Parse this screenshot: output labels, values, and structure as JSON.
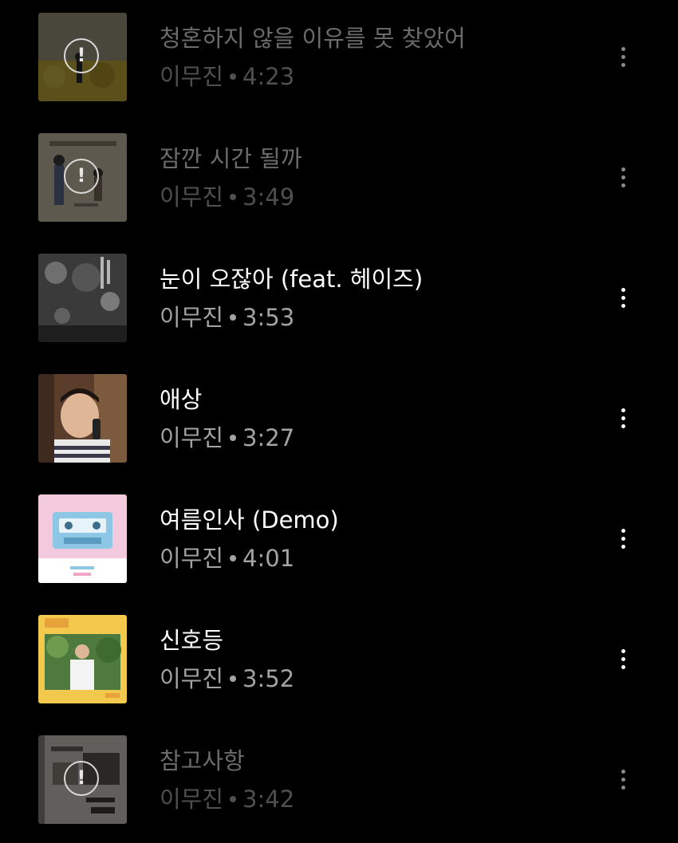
{
  "songs": [
    {
      "title": "청혼하지 않을 이유를 못 찾았어",
      "artist": "이무진",
      "duration": "4:23",
      "available": false,
      "art_icon": "field-silhouette-art"
    },
    {
      "title": "잠깐 시간 될까",
      "artist": "이무진",
      "duration": "3:49",
      "available": false,
      "art_icon": "sketch-art"
    },
    {
      "title": "눈이 오잖아 (feat. 헤이즈)",
      "artist": "이무진",
      "duration": "3:53",
      "available": true,
      "art_icon": "snow-night-art"
    },
    {
      "title": "애상",
      "artist": "이무진",
      "duration": "3:27",
      "available": true,
      "art_icon": "portrait-phone-art"
    },
    {
      "title": "여름인사 (Demo)",
      "artist": "이무진",
      "duration": "4:01",
      "available": true,
      "art_icon": "cassette-art"
    },
    {
      "title": "신호등",
      "artist": "이무진",
      "duration": "3:52",
      "available": true,
      "art_icon": "yellow-frame-art"
    },
    {
      "title": "참고사항",
      "artist": "이무진",
      "duration": "3:42",
      "available": false,
      "art_icon": "notebook-art"
    }
  ],
  "icons": {
    "unavailable": "warning-circle-icon",
    "more": "more-vertical-icon"
  },
  "warning_glyph": "!",
  "colors": {
    "background": "#000000",
    "title": "#ffffff",
    "meta": "#a3a3a3",
    "disabled_title": "#6b6b6b",
    "disabled_meta": "#4f4f4f"
  }
}
